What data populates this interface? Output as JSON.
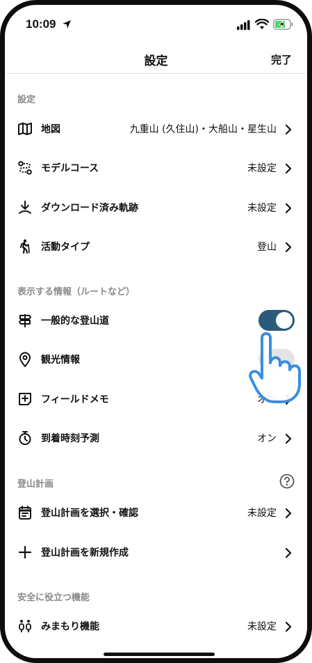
{
  "status_bar": {
    "time": "10:09"
  },
  "nav": {
    "title": "設定",
    "done": "完了"
  },
  "sections": {
    "settings": {
      "header": "設定",
      "rows": [
        {
          "label": "地図",
          "value": "九重山 (久住山)・大船山・星生山"
        },
        {
          "label": "モデルコース",
          "value": "未設定"
        },
        {
          "label": "ダウンロード済み軌跡",
          "value": "未設定"
        },
        {
          "label": "活動タイプ",
          "value": "登山"
        }
      ]
    },
    "display": {
      "header": "表示する情報（ルートなど）",
      "rows": [
        {
          "label": "一般的な登山道",
          "toggle": "on"
        },
        {
          "label": "観光情報",
          "toggle": "off"
        },
        {
          "label": "フィールドメモ",
          "value": "オン"
        },
        {
          "label": "到着時刻予測",
          "value": "オン"
        }
      ]
    },
    "plan": {
      "header": "登山計画",
      "rows": [
        {
          "label": "登山計画を選択・確認",
          "value": "未設定"
        },
        {
          "label": "登山計画を新規作成",
          "value": ""
        }
      ]
    },
    "safety": {
      "header": "安全に役立つ機能",
      "rows": [
        {
          "label": "みまもり機能",
          "value": "未設定"
        }
      ]
    }
  },
  "colors": {
    "toggle_on": "#2c5a7a",
    "accent_hand": "#3b8de0"
  },
  "icons": [
    "map-icon",
    "route-icon",
    "download-icon",
    "hiker-icon",
    "signpost-icon",
    "location-pin-icon",
    "note-add-icon",
    "timer-icon",
    "calendar-icon",
    "plus-icon",
    "people-icon",
    "help-icon",
    "chevron-right-icon"
  ]
}
